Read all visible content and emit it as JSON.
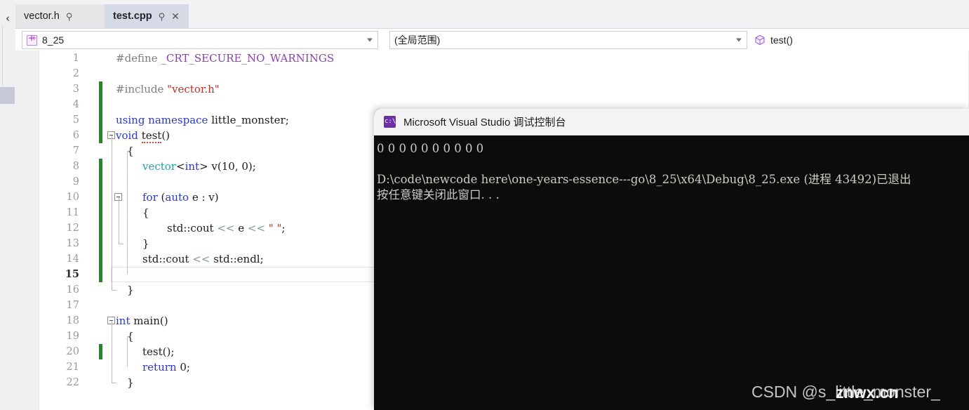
{
  "left_rail": {
    "chevron_icon": "chevron-left-icon",
    "autohide_handle": "autohide-handle"
  },
  "tabs": [
    {
      "label": "vector.h",
      "pin_icon": "pin-icon",
      "active": false,
      "closable": false
    },
    {
      "label": "test.cpp",
      "pin_icon": "pin-icon",
      "close_icon": "close-icon",
      "active": true,
      "closable": true
    }
  ],
  "navbar": {
    "project": {
      "value": "8_25",
      "icon": "cpp-project-icon",
      "dropdown_icon": "chevron-down-icon"
    },
    "scope": {
      "value": "(全局范围)",
      "dropdown_icon": "chevron-down-icon"
    },
    "member": {
      "value": "test()",
      "icon": "method-cube-icon"
    }
  },
  "editor": {
    "current_line": 15,
    "lines": [
      {
        "n": 1,
        "changed": false,
        "indent": 0,
        "tokens": [
          {
            "t": "#define ",
            "c": "t-pre"
          },
          {
            "t": "_CRT_SECURE_NO_WARNINGS",
            "c": "t-macro"
          }
        ]
      },
      {
        "n": 2,
        "changed": false,
        "indent": 0,
        "tokens": []
      },
      {
        "n": 3,
        "changed": true,
        "indent": 0,
        "tokens": [
          {
            "t": "#include ",
            "c": "t-pre"
          },
          {
            "t": "\"vector.h\"",
            "c": "t-str"
          }
        ]
      },
      {
        "n": 4,
        "changed": true,
        "indent": 0,
        "tokens": []
      },
      {
        "n": 5,
        "changed": true,
        "indent": 0,
        "tokens": [
          {
            "t": "using namespace ",
            "c": "t-kw"
          },
          {
            "t": "little_monster;",
            "c": "t-plain"
          }
        ]
      },
      {
        "n": 6,
        "changed": true,
        "indent": 0,
        "fold": true,
        "tokens": [
          {
            "t": "void ",
            "c": "t-kw"
          },
          {
            "t": "test",
            "c": "t-plain squig"
          },
          {
            "t": "()",
            "c": "t-plain"
          }
        ]
      },
      {
        "n": 7,
        "changed": false,
        "indent": 1,
        "tokens": [
          {
            "t": "{",
            "c": "t-plain"
          }
        ]
      },
      {
        "n": 8,
        "changed": true,
        "indent": 2,
        "tokens": [
          {
            "t": "vector",
            "c": "t-type"
          },
          {
            "t": "<",
            "c": "t-plain"
          },
          {
            "t": "int",
            "c": "t-kw"
          },
          {
            "t": "> v(",
            "c": "t-plain"
          },
          {
            "t": "10",
            "c": "t-num"
          },
          {
            "t": ", ",
            "c": "t-plain"
          },
          {
            "t": "0",
            "c": "t-num"
          },
          {
            "t": ");",
            "c": "t-plain"
          }
        ]
      },
      {
        "n": 9,
        "changed": true,
        "indent": 2,
        "tokens": []
      },
      {
        "n": 10,
        "changed": true,
        "indent": 2,
        "fold2": true,
        "tokens": [
          {
            "t": "for ",
            "c": "t-kw"
          },
          {
            "t": "(",
            "c": "t-plain"
          },
          {
            "t": "auto",
            "c": "t-kw"
          },
          {
            "t": " e : v)",
            "c": "t-plain"
          }
        ]
      },
      {
        "n": 11,
        "changed": true,
        "indent": 2,
        "tokens": [
          {
            "t": "{",
            "c": "t-plain"
          }
        ]
      },
      {
        "n": 12,
        "changed": true,
        "indent": 3,
        "tokens": [
          {
            "t": "std::cout ",
            "c": "t-plain"
          },
          {
            "t": "<<",
            "c": "t-op"
          },
          {
            "t": " e ",
            "c": "t-plain"
          },
          {
            "t": "<<",
            "c": "t-op"
          },
          {
            "t": " \" \"",
            "c": "t-str"
          },
          {
            "t": ";",
            "c": "t-plain"
          }
        ]
      },
      {
        "n": 13,
        "changed": true,
        "indent": 2,
        "tokens": [
          {
            "t": "}",
            "c": "t-plain"
          }
        ]
      },
      {
        "n": 14,
        "changed": true,
        "indent": 2,
        "tokens": [
          {
            "t": "std::cout ",
            "c": "t-plain"
          },
          {
            "t": "<<",
            "c": "t-op"
          },
          {
            "t": " std::endl;",
            "c": "t-plain"
          }
        ]
      },
      {
        "n": 15,
        "changed": true,
        "indent": 2,
        "tokens": []
      },
      {
        "n": 16,
        "changed": false,
        "indent": 1,
        "tokens": [
          {
            "t": "}",
            "c": "t-plain"
          }
        ]
      },
      {
        "n": 17,
        "changed": false,
        "indent": 0,
        "tokens": []
      },
      {
        "n": 18,
        "changed": false,
        "indent": 0,
        "fold": true,
        "tokens": [
          {
            "t": "int ",
            "c": "t-kw"
          },
          {
            "t": "main()",
            "c": "t-plain"
          }
        ]
      },
      {
        "n": 19,
        "changed": false,
        "indent": 1,
        "tokens": [
          {
            "t": "{",
            "c": "t-plain"
          }
        ]
      },
      {
        "n": 20,
        "changed": true,
        "indent": 2,
        "tokens": [
          {
            "t": "test();",
            "c": "t-plain"
          }
        ]
      },
      {
        "n": 21,
        "changed": false,
        "indent": 2,
        "tokens": [
          {
            "t": "return ",
            "c": "t-kw"
          },
          {
            "t": "0",
            "c": "t-num"
          },
          {
            "t": ";",
            "c": "t-plain"
          }
        ]
      },
      {
        "n": 22,
        "changed": false,
        "indent": 1,
        "tokens": [
          {
            "t": "}",
            "c": "t-plain"
          }
        ]
      }
    ]
  },
  "console": {
    "title": "Microsoft Visual Studio 调试控制台",
    "icon": "console-app-icon",
    "lines": [
      "0 0 0 0 0 0 0 0 0 0 ",
      "",
      "D:\\code\\newcode here\\one-years-essence---go\\8_25\\x64\\Debug\\8_25.exe (进程 43492)已退出",
      "按任意键关闭此窗口. . ."
    ]
  },
  "watermark": {
    "text": "CSDN @s_little_monster_",
    "overlay": "znwx.cn"
  },
  "colors": {
    "accent": "#2a39c4",
    "change_bar": "#1e8c22",
    "string": "#b5342c",
    "macro": "#8b3fb5",
    "type": "#2a9fa8",
    "console_bg": "#0c0c0c",
    "active_tab": "#d6d9e6"
  }
}
